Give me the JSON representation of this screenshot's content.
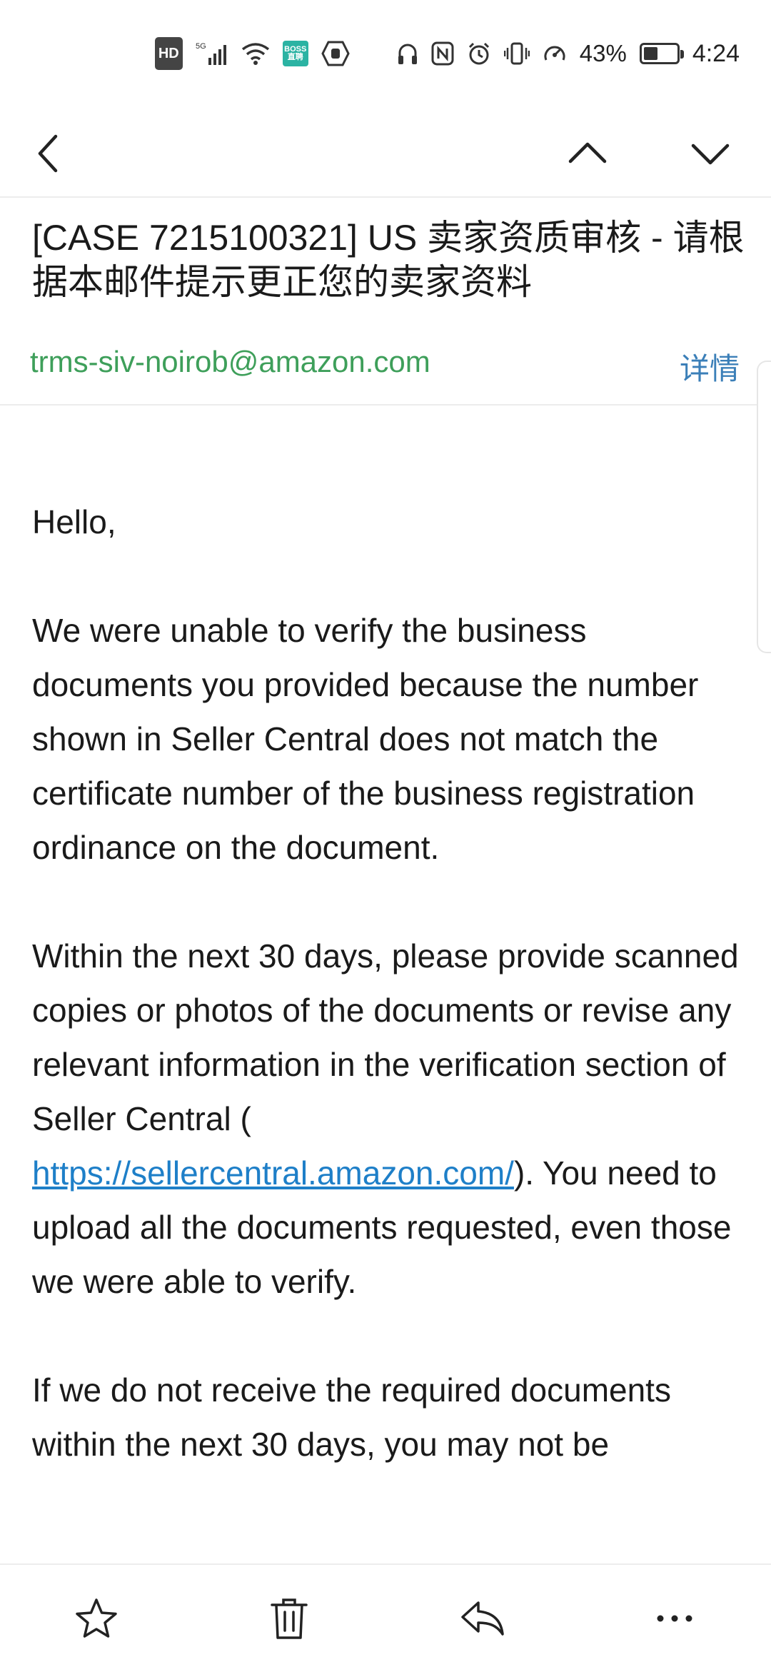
{
  "status_bar": {
    "hd": "HD",
    "network": "5G",
    "boss_badge": "BOSS 直聘",
    "battery": "43%",
    "battery_level": 0.43,
    "time": "4:24"
  },
  "nav": {
    "back_icon": "chevron-left-icon",
    "prev_icon": "chevron-up-icon",
    "next_icon": "chevron-down-icon"
  },
  "email": {
    "subject": "[CASE 7215100321] US 卖家资质审核 - 请根据本邮件提示更正您的卖家资料",
    "sender": "trms-siv-noirob@amazon.com",
    "details_label": "详情",
    "greeting": "Hello,",
    "paragraph1": "We were unable to verify the business documents you provided because the number shown in Seller Central does not match the certificate number of the business registration ordinance on the document.",
    "paragraph2_before": "Within the next 30 days, please provide scanned copies or photos of the documents or revise any relevant information in the verification section of Seller Central (",
    "link": "https://sellercentral.amazon.com/",
    "paragraph2_after": "). You need to upload all the documents requested, even those we were able to verify.",
    "paragraph3": "If we do not receive the required documents within the next 30 days, you may not be"
  },
  "toolbar": {
    "icons": [
      "star-icon",
      "trash-icon",
      "reply-icon",
      "more-icon"
    ]
  },
  "colors": {
    "sender": "#3e9f5a",
    "details": "#3b7fb8",
    "link": "#1e7fc8"
  }
}
